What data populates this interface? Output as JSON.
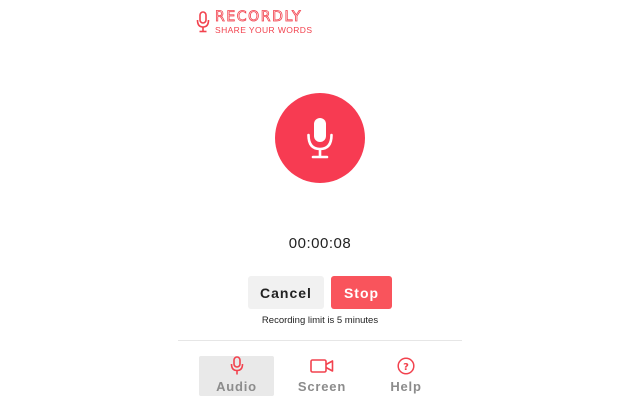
{
  "brand": {
    "name": "RECORDLY",
    "tagline": "SHARE YOUR WORDS",
    "accent_color": "#f73b52",
    "logo_icon": "microphone-icon"
  },
  "recorder": {
    "record_icon": "microphone-icon",
    "timer": "00:00:08",
    "limit_note": "Recording limit is 5 minutes"
  },
  "actions": {
    "cancel_label": "Cancel",
    "stop_label": "Stop"
  },
  "tabs": [
    {
      "label": "Audio",
      "icon": "microphone-icon",
      "active": true
    },
    {
      "label": "Screen",
      "icon": "video-camera-icon",
      "active": false
    },
    {
      "label": "Help",
      "icon": "question-circle-icon",
      "active": false
    }
  ]
}
